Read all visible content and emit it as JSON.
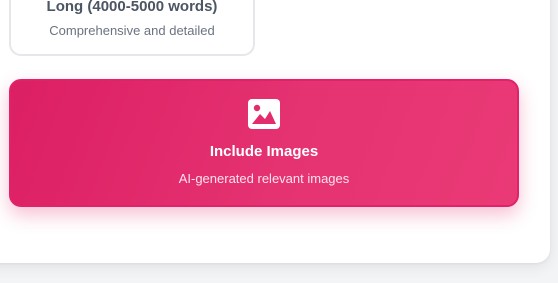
{
  "length_option": {
    "title": "Long (4000-5000 words)",
    "description": "Comprehensive and detailed"
  },
  "images_option": {
    "icon": "image-icon",
    "title": "Include Images",
    "description": "AI-generated relevant images",
    "selected": true,
    "accent_color": "#e53271"
  }
}
